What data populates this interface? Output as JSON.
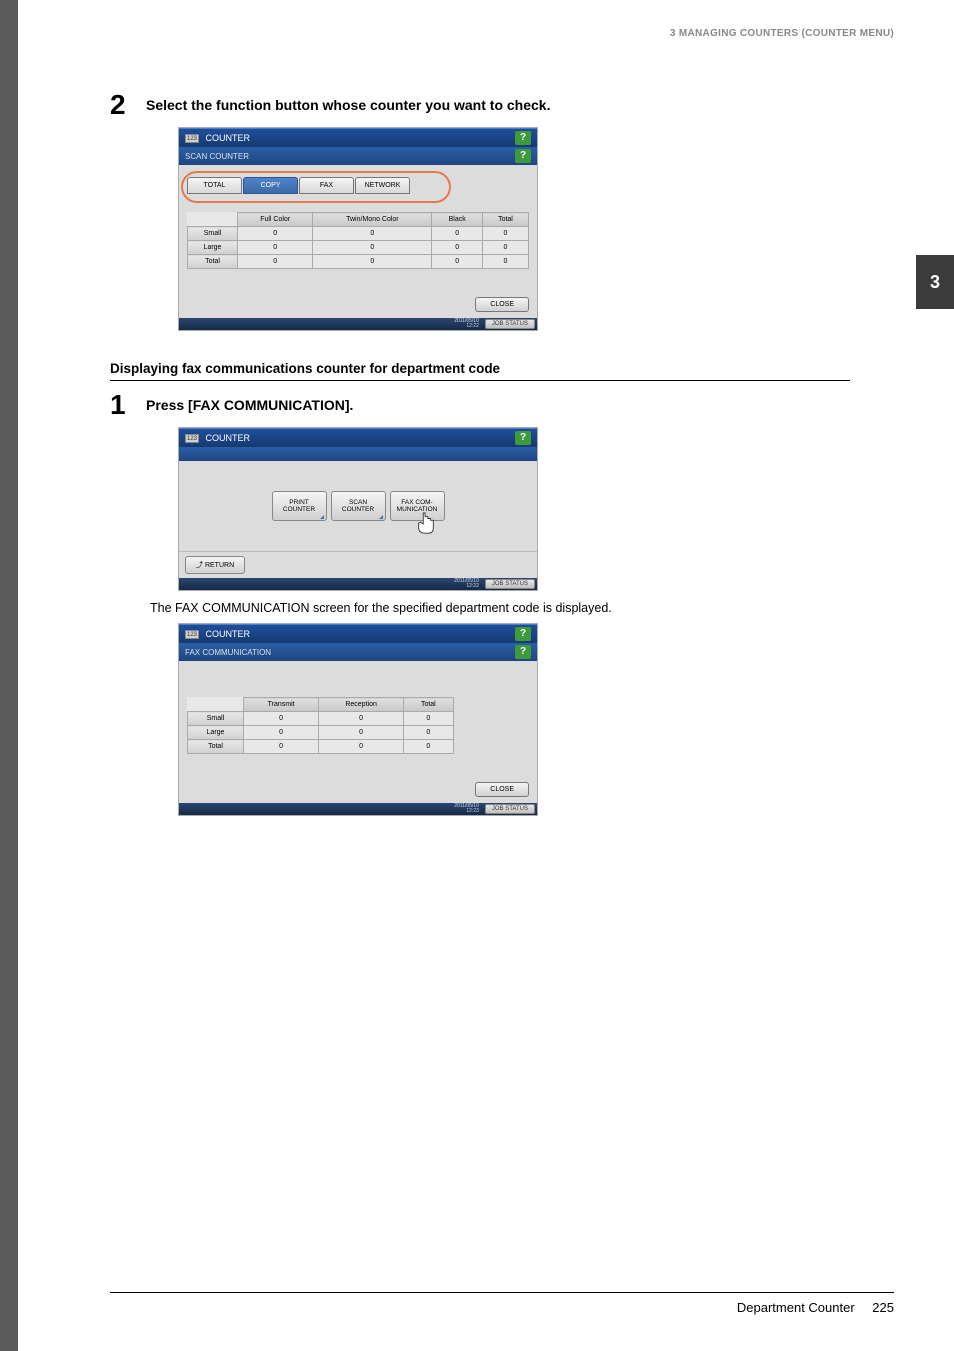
{
  "header": "3 MANAGING COUNTERS (COUNTER MENU)",
  "chapter_tab": "3",
  "step2": {
    "num": "2",
    "text": "Select the function button whose counter you want to check."
  },
  "scanCounterScreen": {
    "titleIcon": "123",
    "title": "COUNTER",
    "subtitle": "SCAN COUNTER",
    "tabs": {
      "total": "TOTAL",
      "copy": "COPY",
      "fax": "FAX",
      "network": "NETWORK"
    },
    "columns": [
      "Full Color",
      "Twin/Mono Color",
      "Black",
      "Total"
    ],
    "rows": [
      {
        "label": "Small",
        "values": [
          "0",
          "0",
          "0",
          "0"
        ]
      },
      {
        "label": "Large",
        "values": [
          "0",
          "0",
          "0",
          "0"
        ]
      },
      {
        "label": "Total",
        "values": [
          "0",
          "0",
          "0",
          "0"
        ]
      }
    ],
    "close": "CLOSE",
    "timestamp": "2011/05/10\n12:22",
    "jobStatus": "JOB STATUS"
  },
  "sectionHeading": "Displaying fax communications counter for department code",
  "step1": {
    "num": "1",
    "text": "Press [FAX COMMUNICATION]."
  },
  "counterSelectScreen": {
    "titleIcon": "123",
    "title": "COUNTER",
    "buttons": {
      "print": "PRINT\nCOUNTER",
      "scan": "SCAN\nCOUNTER",
      "faxcom": "FAX COM-\nMUNICATION"
    },
    "return": "RETURN",
    "timestamp": "2011/05/10\n12:22",
    "jobStatus": "JOB STATUS"
  },
  "bodyAfterStep1": "The FAX COMMUNICATION screen for the specified department code is displayed.",
  "faxComScreen": {
    "titleIcon": "123",
    "title": "COUNTER",
    "subtitle": "FAX COMMUNICATION",
    "columns": [
      "Transmit",
      "Reception",
      "Total"
    ],
    "rows": [
      {
        "label": "Small",
        "values": [
          "0",
          "0",
          "0"
        ]
      },
      {
        "label": "Large",
        "values": [
          "0",
          "0",
          "0"
        ]
      },
      {
        "label": "Total",
        "values": [
          "0",
          "0",
          "0"
        ]
      }
    ],
    "close": "CLOSE",
    "timestamp": "2011/05/10\n12:23",
    "jobStatus": "JOB STATUS"
  },
  "footer": {
    "section": "Department Counter",
    "page": "225"
  }
}
